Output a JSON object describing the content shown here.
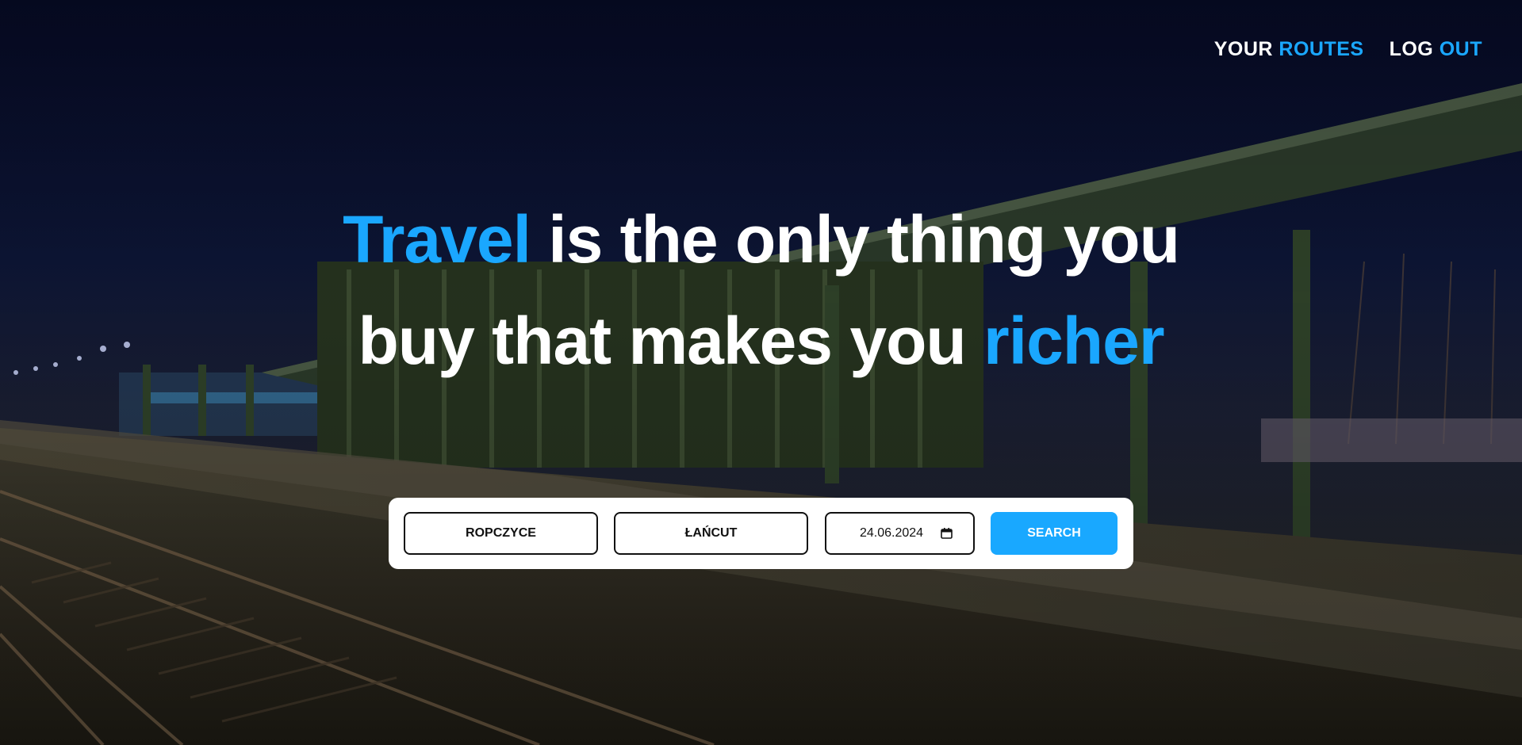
{
  "nav": {
    "routes_part1": "YOUR",
    "routes_part2": "ROUTES",
    "logout_part1": "LOG",
    "logout_part2": "OUT"
  },
  "hero": {
    "line1_accent": "Travel",
    "line1_rest": " is the only thing you",
    "line2_rest": "buy that makes you ",
    "line2_accent": "richer"
  },
  "search": {
    "from_value": "ROPCZYCE",
    "to_value": "ŁAŃCUT",
    "date_value": "24.06.2024",
    "button_label": "SEARCH"
  },
  "colors": {
    "accent": "#1aa7ff",
    "button": "#19a8ff"
  }
}
